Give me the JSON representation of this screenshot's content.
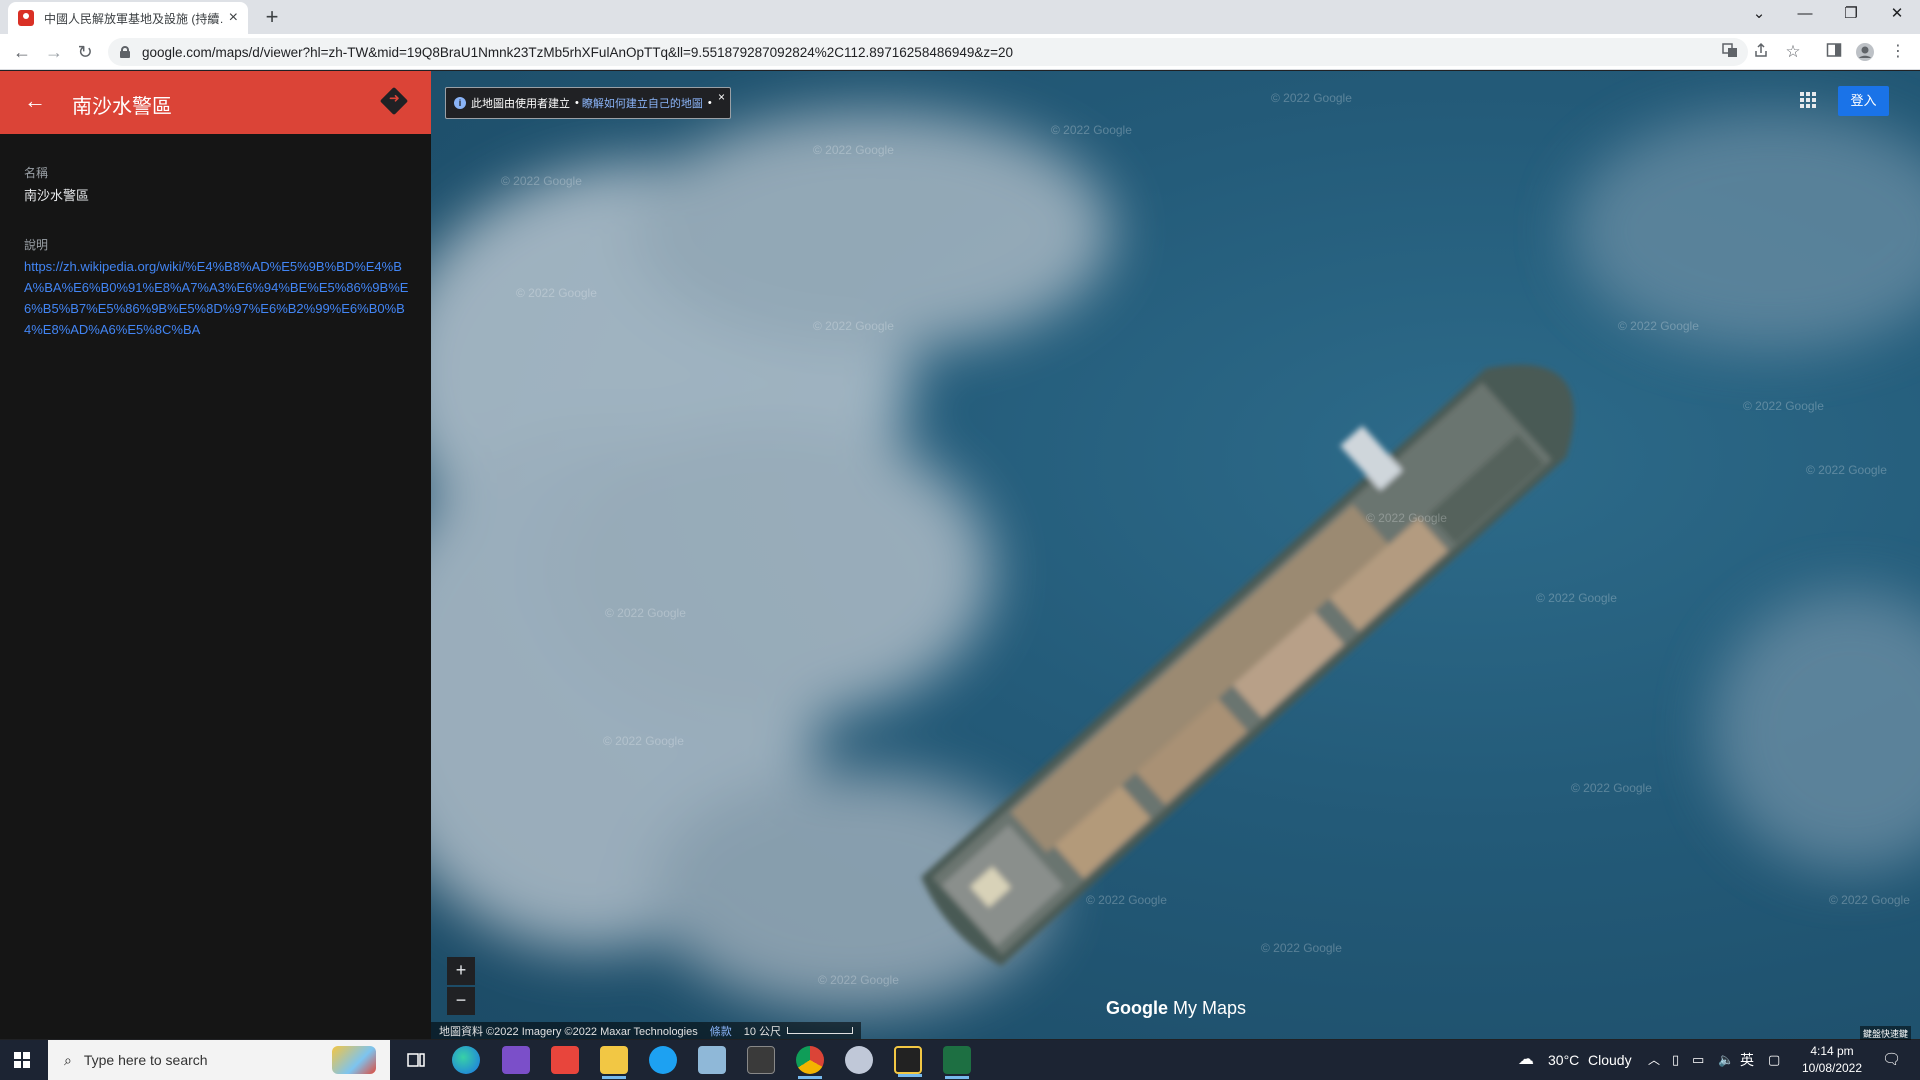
{
  "browser": {
    "tab_title": "中國人民解放軍基地及設施 (持續…",
    "tab_close": "×",
    "new_tab": "+",
    "url": "google.com/maps/d/viewer?hl=zh-TW&mid=19Q8BraU1Nmnk23TzMb5rhXFulAnOpTTq&ll=9.551879287092824%2C112.89716258486949&z=20",
    "window_controls": [
      "⌄",
      "—",
      "❐",
      "✕"
    ],
    "nav": {
      "back": "←",
      "forward": "→",
      "reload": "↻"
    }
  },
  "panel": {
    "title": "南沙水警區",
    "back_icon": "←",
    "name_label": "名稱",
    "name_value": "南沙水警區",
    "desc_label": "說明",
    "desc_link": "https://zh.wikipedia.org/wiki/%E4%B8%AD%E5%9B%BD%E4%BA%BA%E6%B0%91%E8%A7%A3%E6%94%BE%E5%86%9B%E6%B5%B7%E5%86%9B%E5%8D%97%E6%B2%99%E6%B0%B4%E8%AD%A6%E5%8C%BA"
  },
  "map": {
    "info_text": "此地圖由使用者建立",
    "info_bullet": "•",
    "info_link": "瞭解如何建立自己的地圖",
    "info_close": "×",
    "signin": "登入",
    "zoom_in": "+",
    "zoom_out": "−",
    "watermark": "© 2022 Google",
    "logo_google": "Google",
    "logo_mymaps": "My Maps",
    "attribution": "地圖資料 ©2022 Imagery ©2022 Maxar Technologies",
    "terms": "條款",
    "scale": "10 公尺",
    "keyboard_shortcuts": "鍵盤快速鍵"
  },
  "taskbar": {
    "search_placeholder": "Type here to search",
    "weather_temp": "30°C",
    "weather_desc": "Cloudy",
    "ime": "英",
    "time": "4:14 pm",
    "date": "10/08/2022"
  }
}
